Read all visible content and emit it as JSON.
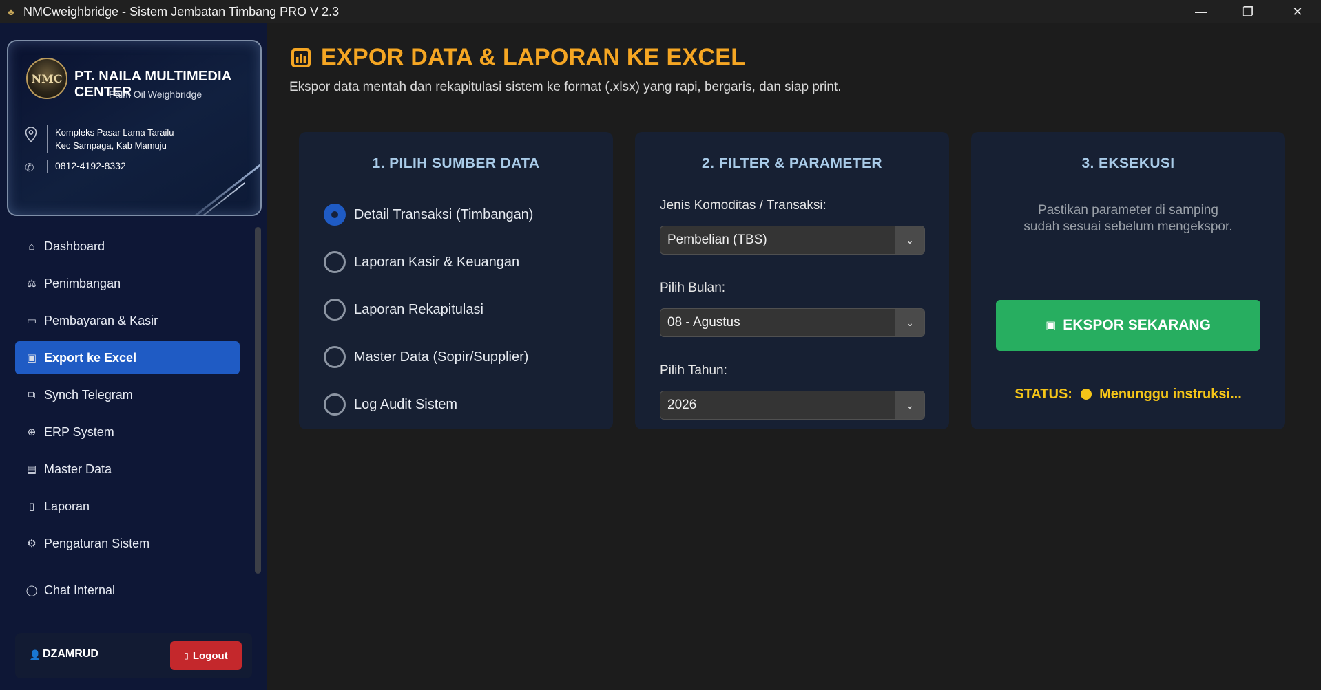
{
  "window": {
    "title": "NMCweighbridge - Sistem Jembatan Timbang PRO V 2.3",
    "min_icon": "minimize-icon",
    "max_icon": "maximize-icon",
    "close_icon": "close-icon"
  },
  "brand": {
    "logo_text": "NMC",
    "company": "PT. NAILA MULTIMEDIA CENTER",
    "tagline": "Palm Oil Weighbridge",
    "address_line1": "Kompleks Pasar Lama Tarailu",
    "address_line2": "Kec Sampaga, Kab Mamuju",
    "phone": "0812-4192-8332"
  },
  "sidebar": {
    "items": [
      {
        "label": "Dashboard",
        "icon": "home-icon",
        "glyph": "⌂"
      },
      {
        "label": "Penimbangan",
        "icon": "scale-icon",
        "glyph": "⚖"
      },
      {
        "label": "Pembayaran & Kasir",
        "icon": "card-icon",
        "glyph": "▭"
      },
      {
        "label": "Export ke Excel",
        "icon": "export-icon",
        "glyph": "▣"
      },
      {
        "label": "Synch Telegram",
        "icon": "sync-icon",
        "glyph": "⧉"
      },
      {
        "label": "ERP System",
        "icon": "globe-icon",
        "glyph": "⊕"
      },
      {
        "label": "Master Data",
        "icon": "folder-icon",
        "glyph": "▤"
      },
      {
        "label": "Laporan",
        "icon": "document-icon",
        "glyph": "▯"
      },
      {
        "label": "Pengaturan Sistem",
        "icon": "gear-icon",
        "glyph": "⚙"
      },
      {
        "label": "Chat Internal",
        "icon": "chat-icon",
        "glyph": "◯"
      }
    ],
    "active_index": 3
  },
  "user": {
    "name": "DZAMRUD",
    "logout_label": "Logout"
  },
  "page": {
    "title": "EXPOR DATA & LAPORAN KE EXCEL",
    "subtitle": "Ekspor data mentah dan rekapitulasi sistem ke format (.xlsx) yang rapi, bergaris, dan siap print.",
    "accent_color": "#f5a623"
  },
  "source_card": {
    "title": "1. PILIH SUMBER DATA",
    "options": [
      {
        "label": "Detail Transaksi (Timbangan)",
        "checked": true
      },
      {
        "label": "Laporan Kasir & Keuangan",
        "checked": false
      },
      {
        "label": "Laporan Rekapitulasi",
        "checked": false
      },
      {
        "label": "Master Data (Sopir/Supplier)",
        "checked": false
      },
      {
        "label": "Log Audit Sistem",
        "checked": false
      }
    ]
  },
  "filter_card": {
    "title": "2. FILTER & PARAMETER",
    "commodity_label": "Jenis Komoditas / Transaksi:",
    "commodity_value": "Pembelian (TBS)",
    "month_label": "Pilih Bulan:",
    "month_value": "08 - Agustus",
    "year_label": "Pilih Tahun:",
    "year_value": "2026"
  },
  "exec_card": {
    "title": "3. EKSEKUSI",
    "note_line1": "Pastikan parameter di samping",
    "note_line2": "sudah sesuai sebelum mengekspor.",
    "button_label": "EKSPOR SEKARANG",
    "status_label": "STATUS:",
    "status_text": "Menunggu instruksi...",
    "button_color": "#27ae60",
    "status_color": "#f5c518"
  }
}
